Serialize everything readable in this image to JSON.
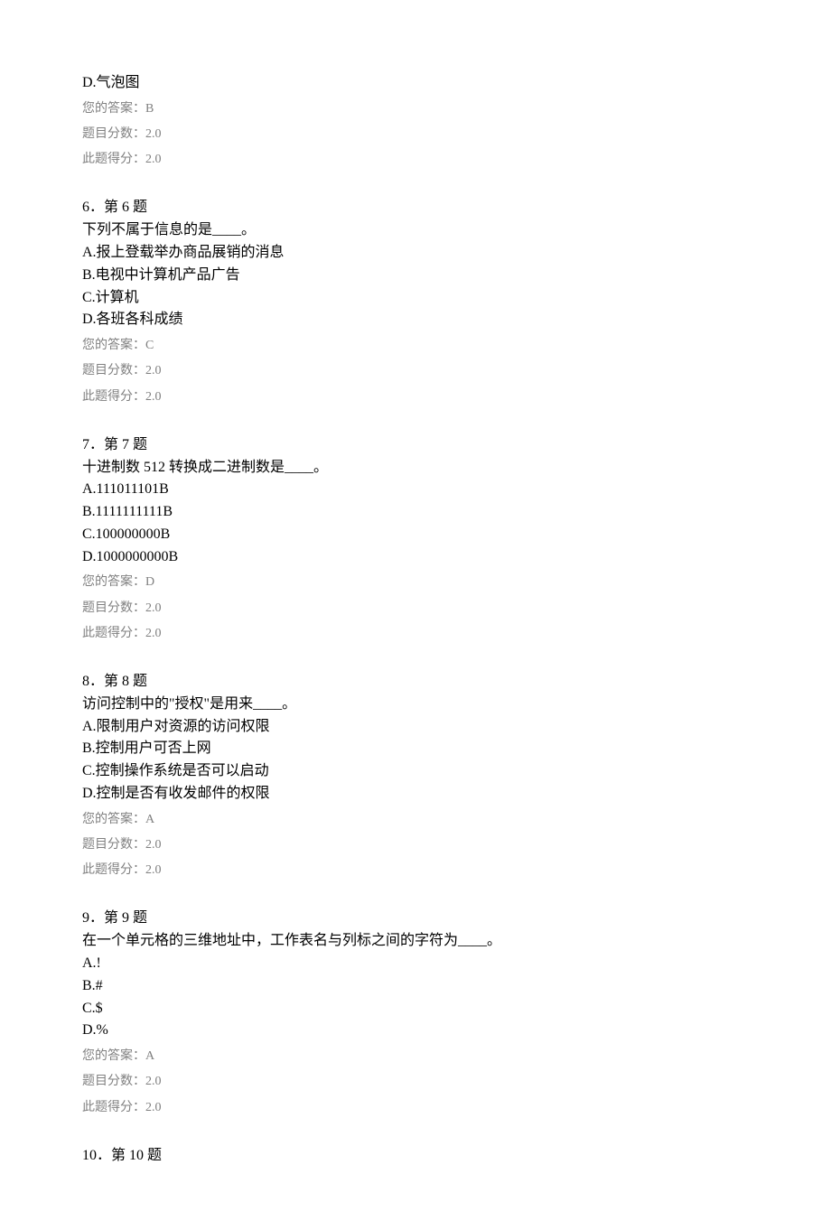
{
  "tail": {
    "optionD": "D.气泡图",
    "your_answer": "您的答案：B",
    "score_label": "题目分数：2.0",
    "earned_label": "此题得分：2.0"
  },
  "questions": [
    {
      "header": "6．第 6 题",
      "stem": "下列不属于信息的是____。",
      "options": [
        "A.报上登载举办商品展销的消息",
        "B.电视中计算机产品广告",
        "C.计算机",
        "D.各班各科成绩"
      ],
      "your_answer": "您的答案：C",
      "score_label": "题目分数：2.0",
      "earned_label": "此题得分：2.0"
    },
    {
      "header": "7．第 7 题",
      "stem": "十进制数 512 转换成二进制数是____。",
      "options": [
        "A.111011101B",
        "B.1111111111B",
        "C.100000000B",
        "D.1000000000B"
      ],
      "your_answer": "您的答案：D",
      "score_label": "题目分数：2.0",
      "earned_label": "此题得分：2.0"
    },
    {
      "header": "8．第 8 题",
      "stem": "访问控制中的\"授权\"是用来____。",
      "options": [
        "A.限制用户对资源的访问权限",
        "B.控制用户可否上网",
        "C.控制操作系统是否可以启动",
        "D.控制是否有收发邮件的权限"
      ],
      "your_answer": "您的答案：A",
      "score_label": "题目分数：2.0",
      "earned_label": "此题得分：2.0"
    },
    {
      "header": "9．第 9 题",
      "stem": "在一个单元格的三维地址中，工作表名与列标之间的字符为____。",
      "options": [
        "A.!",
        "B.#",
        "C.$",
        "D.%"
      ],
      "your_answer": "您的答案：A",
      "score_label": "题目分数：2.0",
      "earned_label": "此题得分：2.0"
    }
  ],
  "next": {
    "header": "10．第 10 题"
  }
}
